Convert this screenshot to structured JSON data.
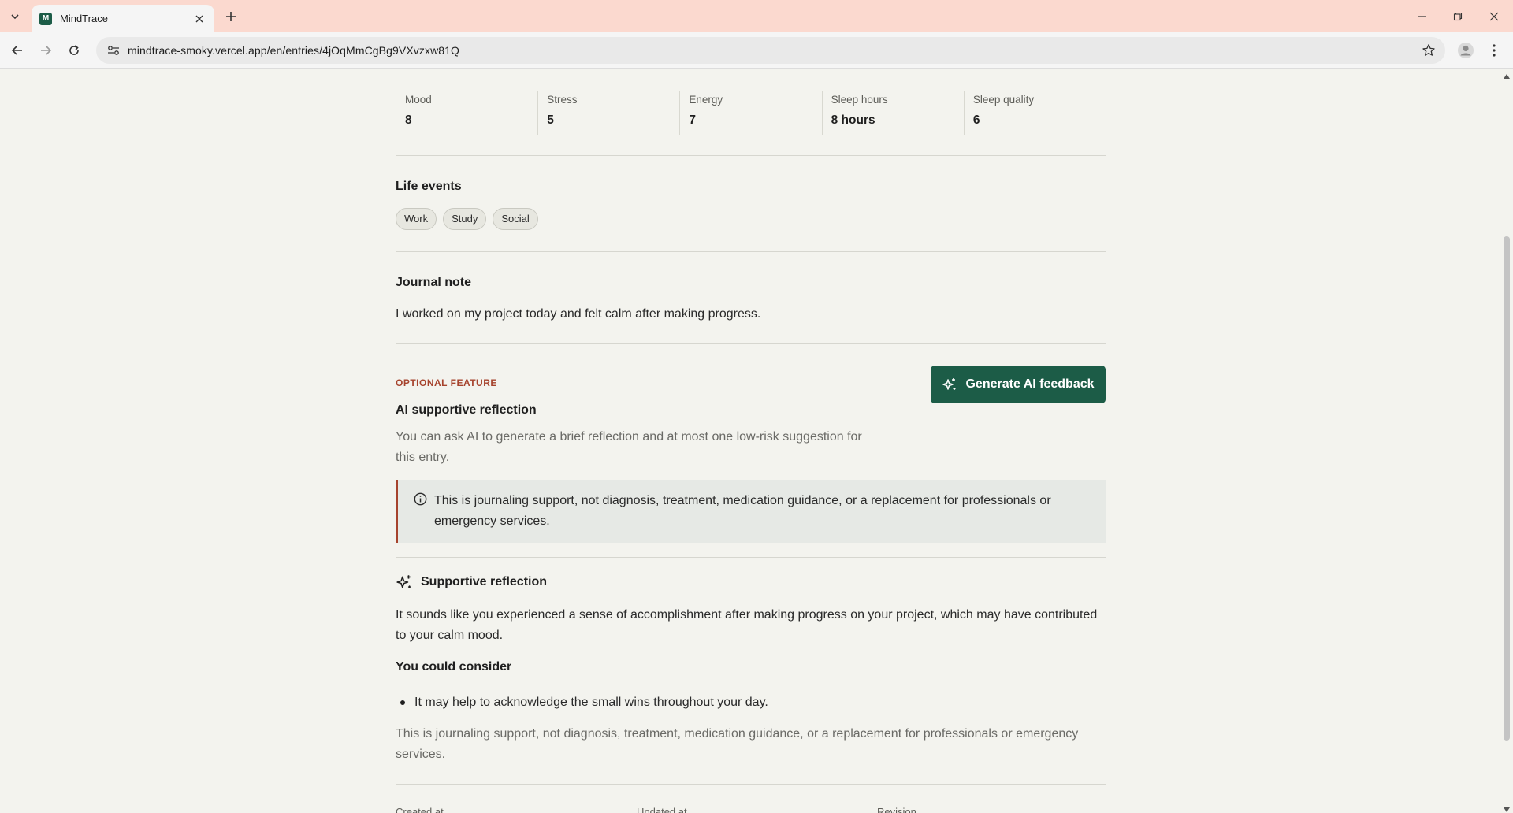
{
  "browser": {
    "tab_title": "MindTrace",
    "favicon_letter": "M",
    "url": "mindtrace-smoky.vercel.app/en/entries/4jOqMmCgBg9VXvzxw81Q"
  },
  "metrics": [
    {
      "label": "Mood",
      "value": "8"
    },
    {
      "label": "Stress",
      "value": "5"
    },
    {
      "label": "Energy",
      "value": "7"
    },
    {
      "label": "Sleep hours",
      "value": "8 hours"
    },
    {
      "label": "Sleep quality",
      "value": "6"
    }
  ],
  "life_events": {
    "title": "Life events",
    "chips": [
      "Work",
      "Study",
      "Social"
    ]
  },
  "journal": {
    "title": "Journal note",
    "text": "I worked on my project today and felt calm after making progress."
  },
  "ai": {
    "eyebrow": "Optional feature",
    "title": "AI supportive reflection",
    "description": "You can ask AI to generate a brief reflection and at most one low-risk suggestion for this entry.",
    "button_label": "Generate AI feedback",
    "notice": "This is journaling support, not diagnosis, treatment, medication guidance, or a replacement for professionals or emergency services."
  },
  "reflection": {
    "title": "Supportive reflection",
    "text": "It sounds like you experienced a sense of accomplishment after making progress on your project, which may have contributed to your calm mood.",
    "consider_title": "You could consider",
    "suggestions": [
      "It may help to acknowledge the small wins throughout your day."
    ],
    "disclaimer": "This is journaling support, not diagnosis, treatment, medication guidance, or a replacement for professionals or emergency services."
  },
  "meta": {
    "created_label": "Created at",
    "updated_label": "Updated at",
    "revision_label": "Revision"
  },
  "colors": {
    "accent_green": "#1c5c47",
    "accent_red": "#a6432d",
    "page_bg": "#f3f3ee",
    "tabbar_bg": "#fbd9cf"
  }
}
